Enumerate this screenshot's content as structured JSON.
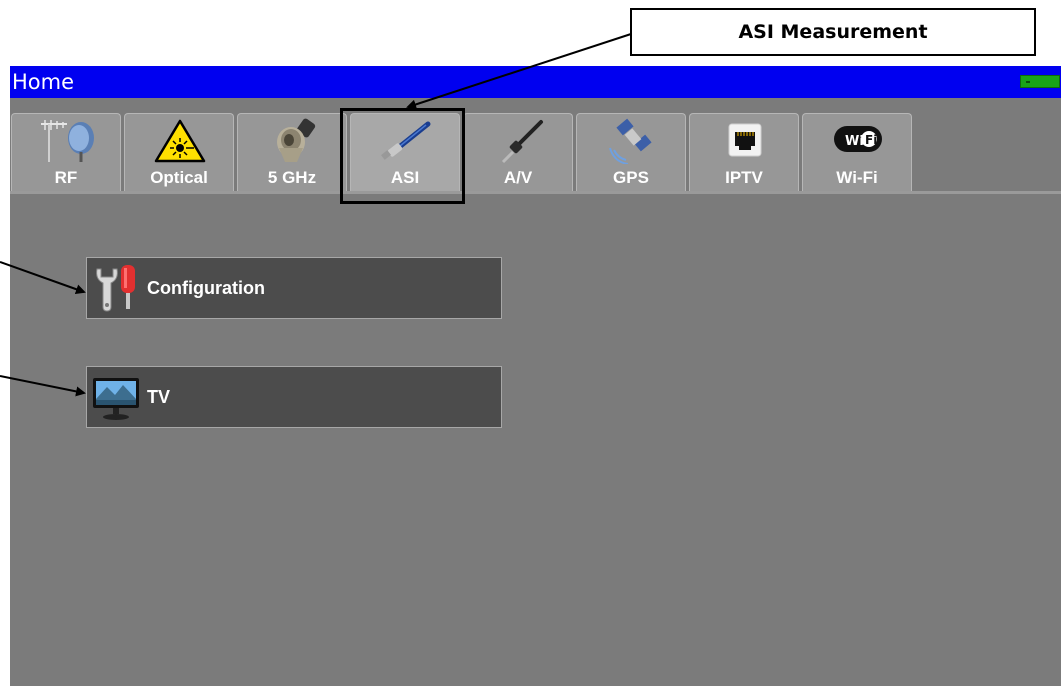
{
  "callout": {
    "label": "ASI Measurement"
  },
  "window": {
    "title": "Home",
    "battery_icon": "battery-icon"
  },
  "tabs": [
    {
      "label": "RF",
      "icon": "antenna-satellite-dish-icon",
      "active": false
    },
    {
      "label": "Optical",
      "icon": "laser-warning-icon",
      "active": false
    },
    {
      "label": "5 GHz",
      "icon": "n-connector-icon",
      "active": false
    },
    {
      "label": "ASI",
      "icon": "asi-cable-icon",
      "active": true
    },
    {
      "label": "A/V",
      "icon": "av-jack-cable-icon",
      "active": false
    },
    {
      "label": "GPS",
      "icon": "gps-satellite-icon",
      "active": false
    },
    {
      "label": "IPTV",
      "icon": "ethernet-port-icon",
      "active": false
    },
    {
      "label": "Wi-Fi",
      "icon": "wifi-logo-icon",
      "active": false
    }
  ],
  "menu": {
    "configuration_label": "Configuration",
    "configuration_icon": "wrench-screwdriver-icon",
    "tv_label": "TV",
    "tv_icon": "tv-monitor-icon"
  },
  "colors": {
    "titlebar": "#0000f0",
    "screen_bg": "#7b7b7b",
    "tab_bg": "#979797",
    "menu_button_bg": "#4c4c4c",
    "battery": "#18a418"
  }
}
